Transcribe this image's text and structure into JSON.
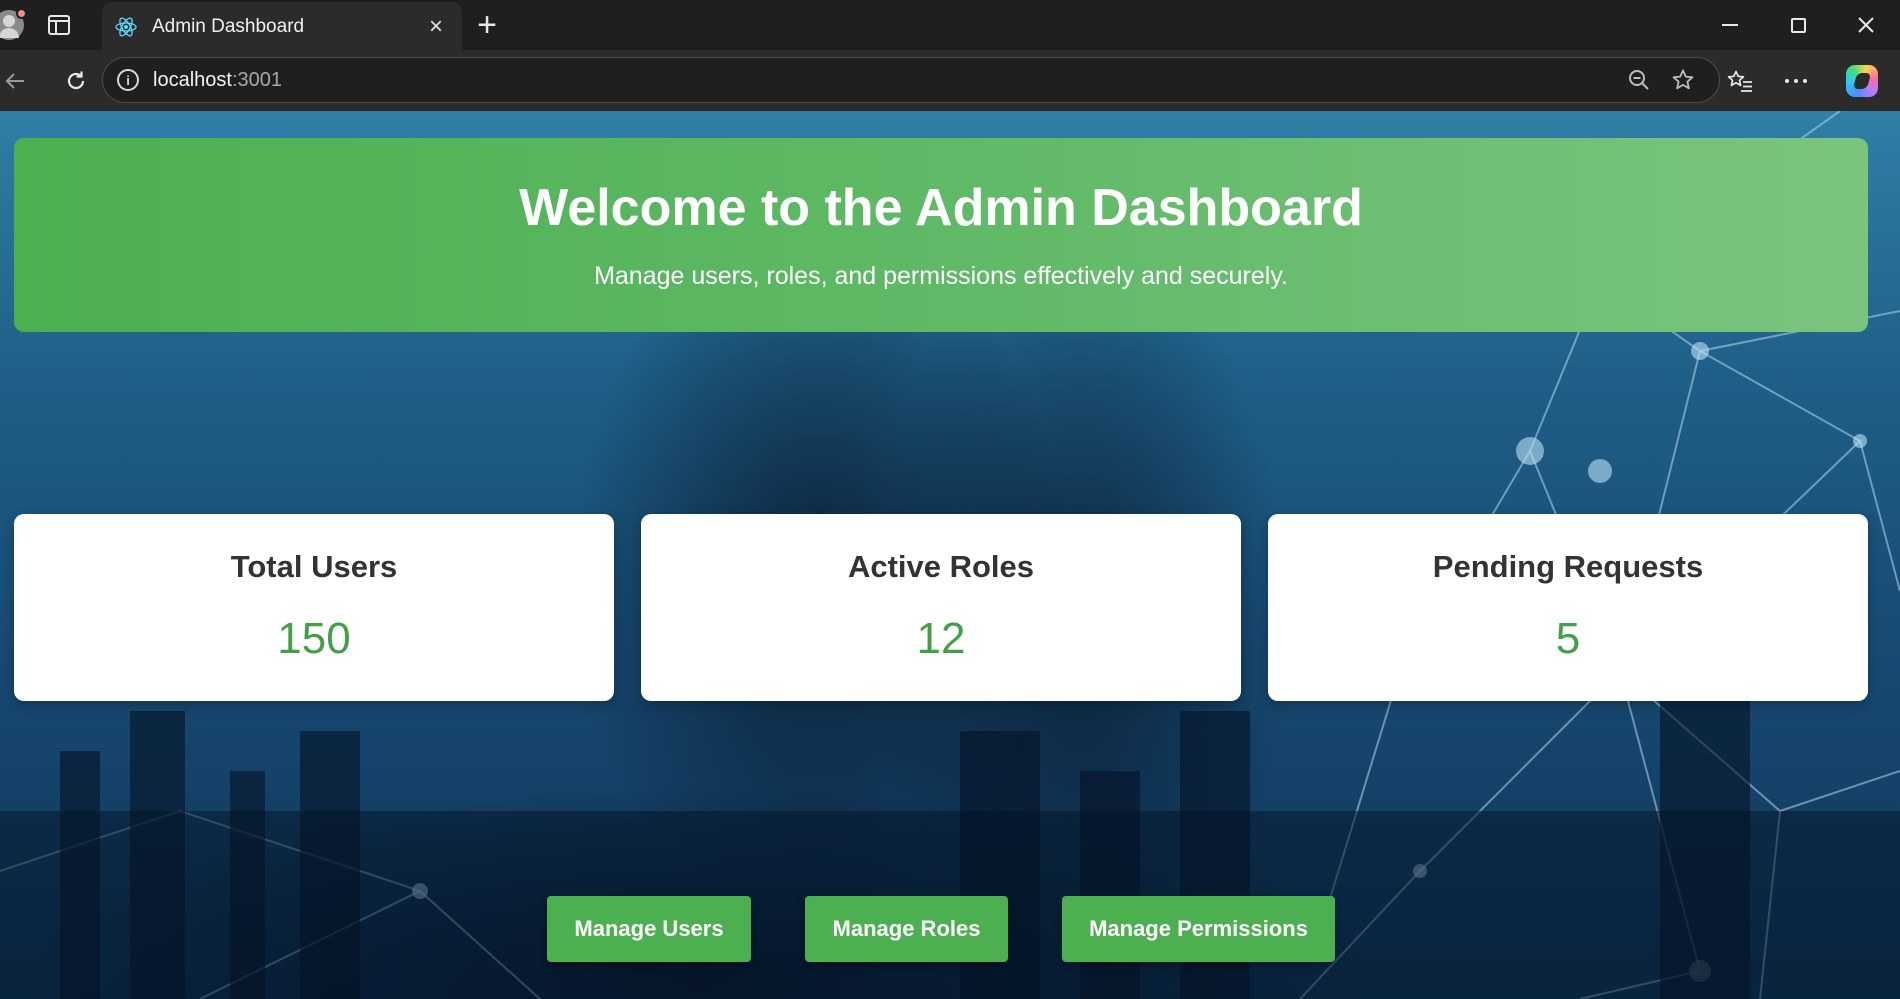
{
  "browser": {
    "tab_title": "Admin Dashboard",
    "url_host": "localhost",
    "url_port": ":3001",
    "new_tab_glyph": "+",
    "close_glyph": "×",
    "icons": [
      "profile-icon",
      "tab-actions-icon",
      "react-icon",
      "close-icon",
      "new-tab-icon",
      "minimize-icon",
      "restore-icon",
      "window-close-icon",
      "back-icon",
      "reload-icon",
      "site-info-icon",
      "zoom-out-icon",
      "favorite-star-icon",
      "favorites-icon",
      "more-icon",
      "copilot-icon"
    ]
  },
  "hero": {
    "title": "Welcome to the Admin Dashboard",
    "subtitle": "Manage users, roles, and permissions effectively and securely."
  },
  "stats": [
    {
      "label": "Total Users",
      "value": "150"
    },
    {
      "label": "Active Roles",
      "value": "12"
    },
    {
      "label": "Pending Requests",
      "value": "5"
    }
  ],
  "actions": [
    {
      "label": "Manage Users"
    },
    {
      "label": "Manage Roles"
    },
    {
      "label": "Manage Permissions"
    }
  ],
  "colors": {
    "accent_green": "#4caf50",
    "stat_value_green": "#43a047",
    "browser_frame": "#1f1f1f",
    "browser_toolbar": "#2b2b2b"
  }
}
